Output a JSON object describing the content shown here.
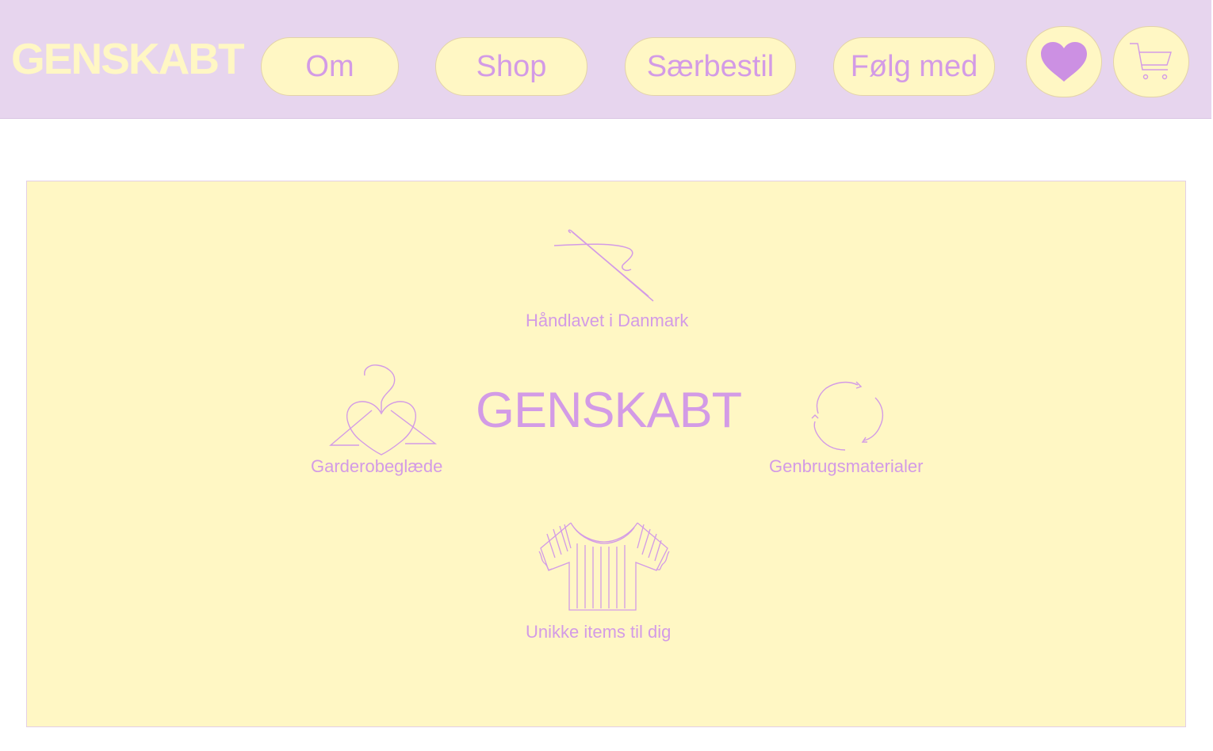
{
  "header": {
    "logo": "GENSKABT",
    "nav": [
      {
        "label": "Om"
      },
      {
        "label": "Shop"
      },
      {
        "label": "Særbestil"
      },
      {
        "label": "Følg med"
      }
    ],
    "icons": [
      "heart-icon",
      "cart-icon"
    ]
  },
  "hero": {
    "title": "GENSKABT",
    "features": [
      {
        "label": "Håndlavet i Danmark",
        "icon": "needle-icon"
      },
      {
        "label": "Garderobeglæde",
        "icon": "heart-hanger-icon"
      },
      {
        "label": "Genbrugsmaterialer",
        "icon": "recycle-icon"
      },
      {
        "label": "Unikke items til dig",
        "icon": "shirt-icon"
      }
    ]
  },
  "colors": {
    "header_bg": "#e7d5ee",
    "pill_bg": "#fff7c4",
    "accent": "#d39be6",
    "logo": "#fff7c4"
  }
}
